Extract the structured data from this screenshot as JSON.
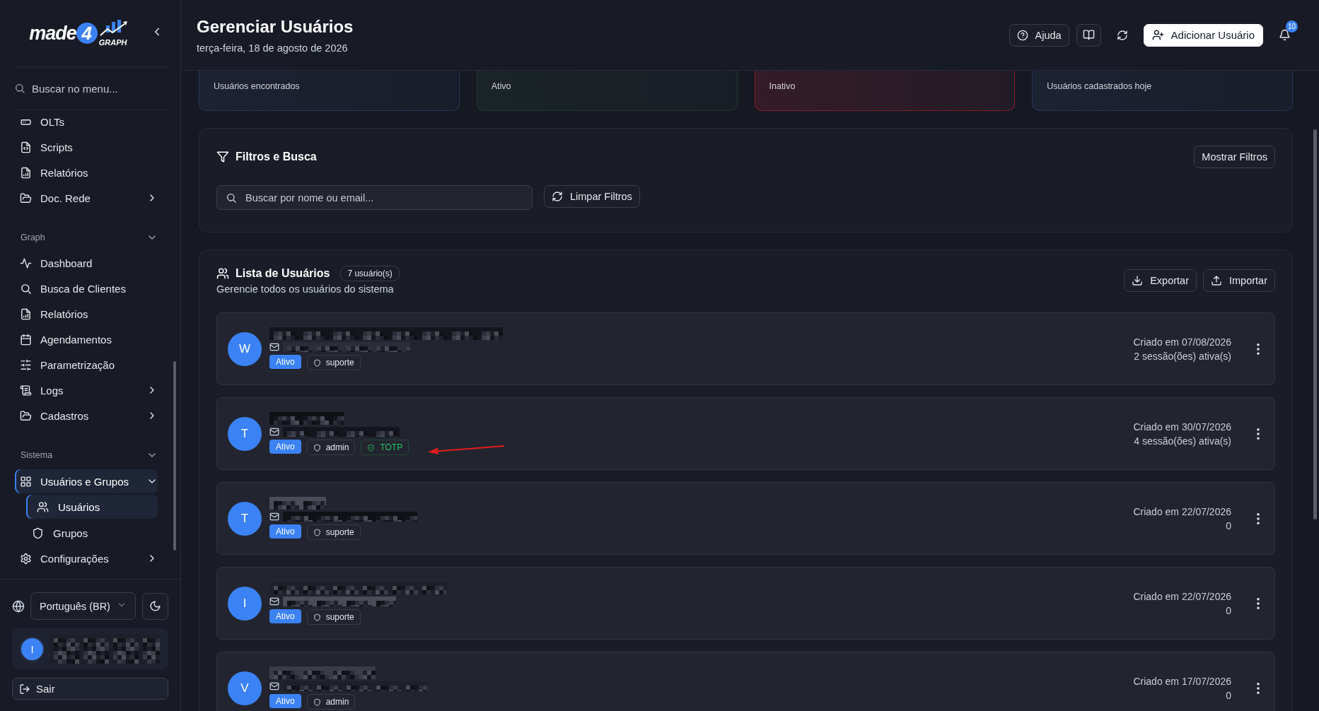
{
  "sidebar": {
    "logo": {
      "word": "made",
      "digit": "4",
      "tag": "GRAPH"
    },
    "search": {
      "placeholder": "Buscar no menu..."
    },
    "groups": [
      {
        "items": [
          {
            "label": "OLTs",
            "selected": false
          },
          {
            "label": "Scripts",
            "selected": false
          },
          {
            "label": "Relatórios",
            "selected": false
          },
          {
            "label": "Doc. Rede",
            "selected": false,
            "expanded": false
          }
        ]
      },
      {
        "title": "Graph",
        "expanded": true,
        "items": [
          {
            "label": "Dashboard",
            "selected": false
          },
          {
            "label": "Busca de Clientes",
            "selected": false
          },
          {
            "label": "Relatórios",
            "selected": false
          },
          {
            "label": "Agendamentos",
            "selected": false
          },
          {
            "label": "Parametrização",
            "selected": false
          },
          {
            "label": "Logs",
            "selected": false,
            "expanded": false
          },
          {
            "label": "Cadastros",
            "selected": false,
            "expanded": false
          }
        ]
      },
      {
        "title": "Sistema",
        "expanded": true,
        "items": [
          {
            "label": "Usuários e Grupos",
            "selected": true,
            "expanded": true,
            "children": [
              {
                "label": "Usuários",
                "selected": true
              },
              {
                "label": "Grupos",
                "selected": false
              }
            ]
          },
          {
            "label": "Configurações",
            "selected": false,
            "expanded": false
          }
        ]
      }
    ],
    "language": "Português (BR)",
    "user": {
      "initial": "I"
    },
    "logout": "Sair"
  },
  "header": {
    "title": "Gerenciar Usuários",
    "date": "terça-feira, 18 de agosto de 2026",
    "help": "Ajuda",
    "add_user": "Adicionar Usuário",
    "notifications": "10"
  },
  "stats": [
    {
      "label": "Usuários encontrados",
      "color": "#263656"
    },
    {
      "label": "Ativo",
      "color": "#1f3a30"
    },
    {
      "label": "Inativo",
      "color": "#7f1d2d"
    },
    {
      "label": "Usuários cadastrados hoje",
      "color": "#263656"
    }
  ],
  "filters": {
    "title": "Filtros e Busca",
    "toggle": "Mostrar Filtros",
    "search": {
      "placeholder": "Buscar por nome ou email..."
    },
    "clear": "Limpar Filtros"
  },
  "users": {
    "title": "Lista de Usuários",
    "count": "7 usuário(s)",
    "subtitle": "Gerencie todos os usuários do sistema",
    "export": "Exportar",
    "import": "Importar",
    "rows": [
      {
        "initial": "W",
        "status": "Ativo",
        "tags": [
          {
            "kind": "role",
            "label": "suporte"
          }
        ],
        "created": "Criado em 07/08/2026",
        "sessions": "2 sessão(ões) ativa(s)",
        "pointed": false
      },
      {
        "initial": "T",
        "status": "Ativo",
        "tags": [
          {
            "kind": "role",
            "label": "admin"
          },
          {
            "kind": "totp",
            "label": "TOTP"
          }
        ],
        "created": "Criado em 30/07/2026",
        "sessions": "4 sessão(ões) ativa(s)",
        "pointed": true
      },
      {
        "initial": "T",
        "status": "Ativo",
        "tags": [
          {
            "kind": "role",
            "label": "suporte"
          }
        ],
        "created": "Criado em 22/07/2026",
        "sessions": "0",
        "pointed": false
      },
      {
        "initial": "I",
        "status": "Ativo",
        "tags": [
          {
            "kind": "role",
            "label": "suporte"
          }
        ],
        "created": "Criado em 22/07/2026",
        "sessions": "0",
        "pointed": false
      },
      {
        "initial": "V",
        "status": "Ativo",
        "tags": [
          {
            "kind": "role",
            "label": "admin"
          }
        ],
        "created": "Criado em 17/07/2026",
        "sessions": "0",
        "pointed": false
      }
    ]
  }
}
